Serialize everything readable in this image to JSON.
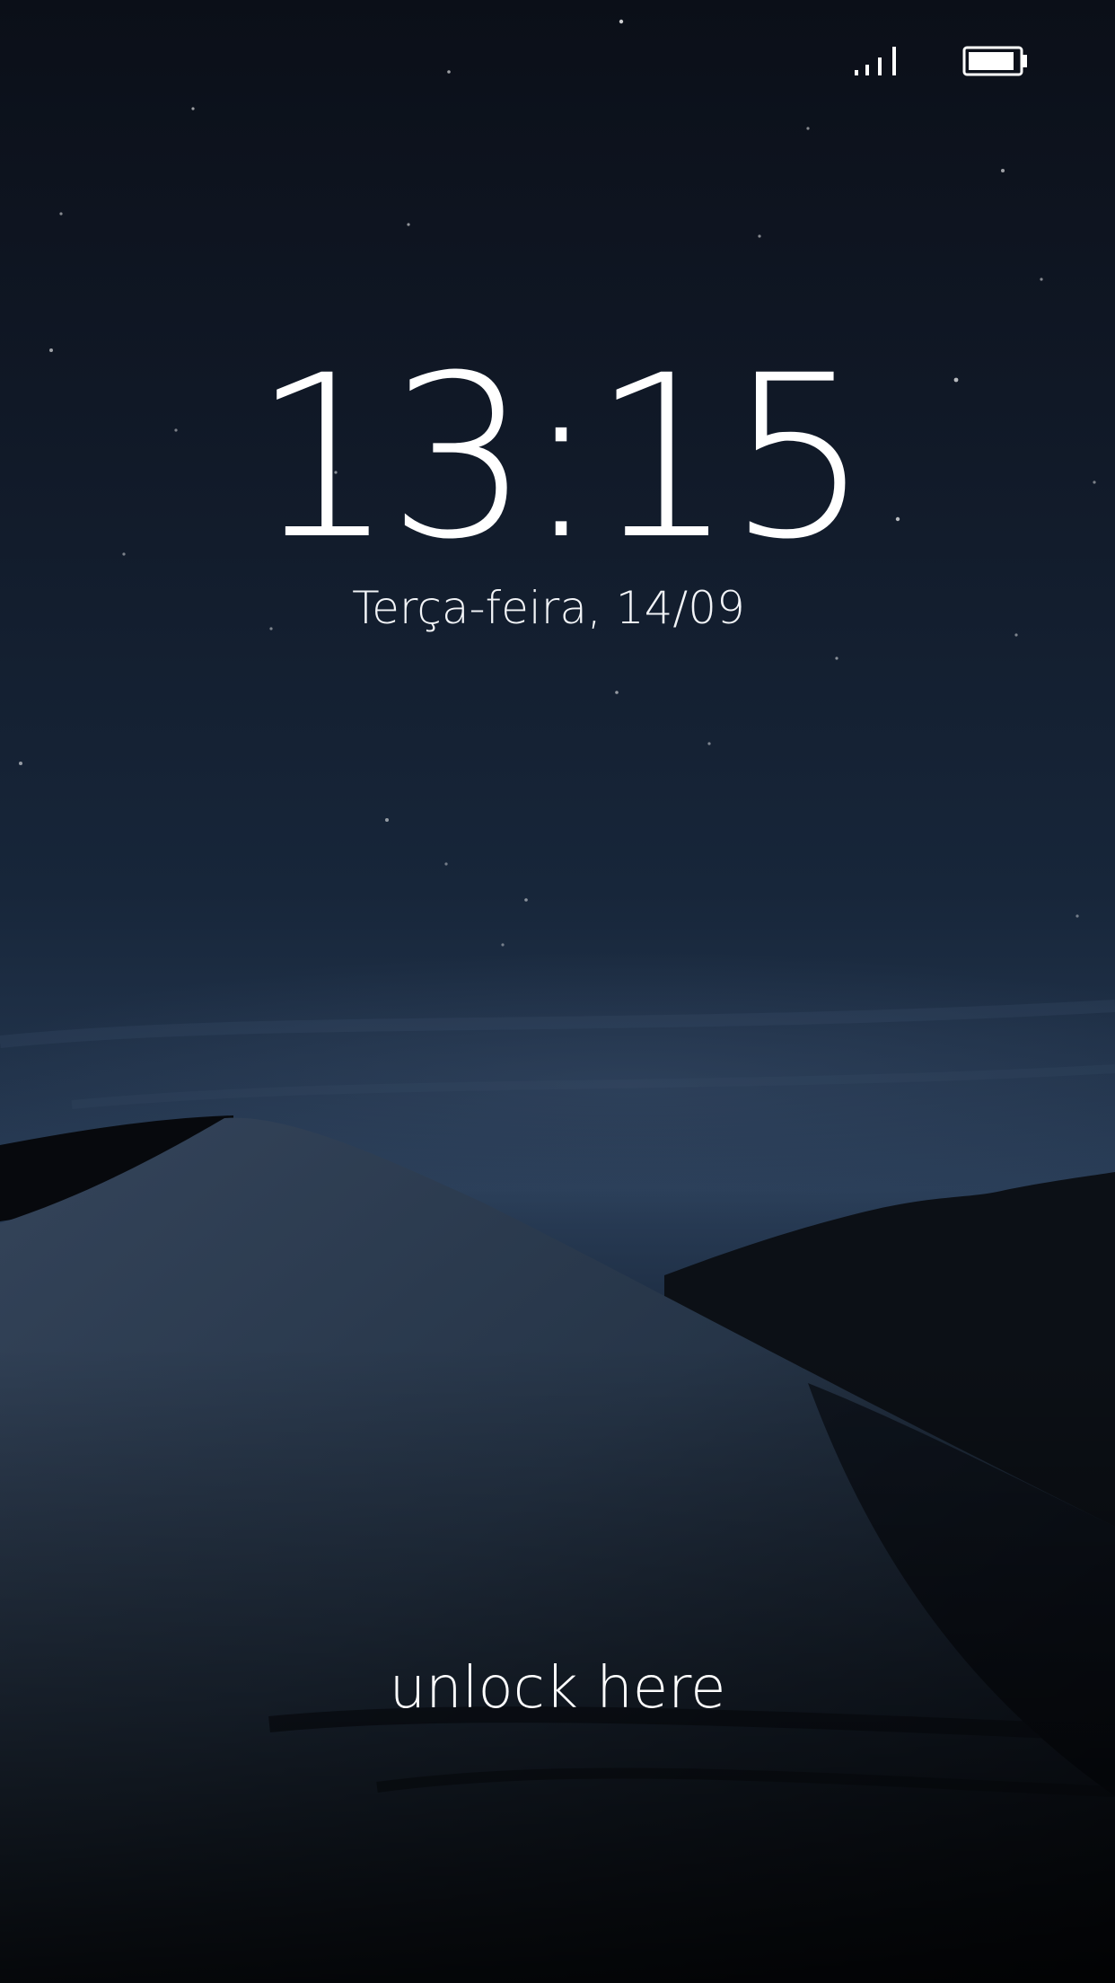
{
  "lock_screen": {
    "time": "13:15",
    "date": "Terça-feira, 14/09",
    "unlock_label": "unlock here"
  },
  "status_bar": {
    "signal_icon": "signal-strength-icon",
    "battery_icon": "battery-low-icon"
  },
  "wallpaper": {
    "subject": "night desert dune",
    "colors": {
      "sky_top": "#0b0f18",
      "sky_horizon": "#2a3e58",
      "dune_light": "#2c3a4d",
      "foreground": "#05070b"
    }
  }
}
